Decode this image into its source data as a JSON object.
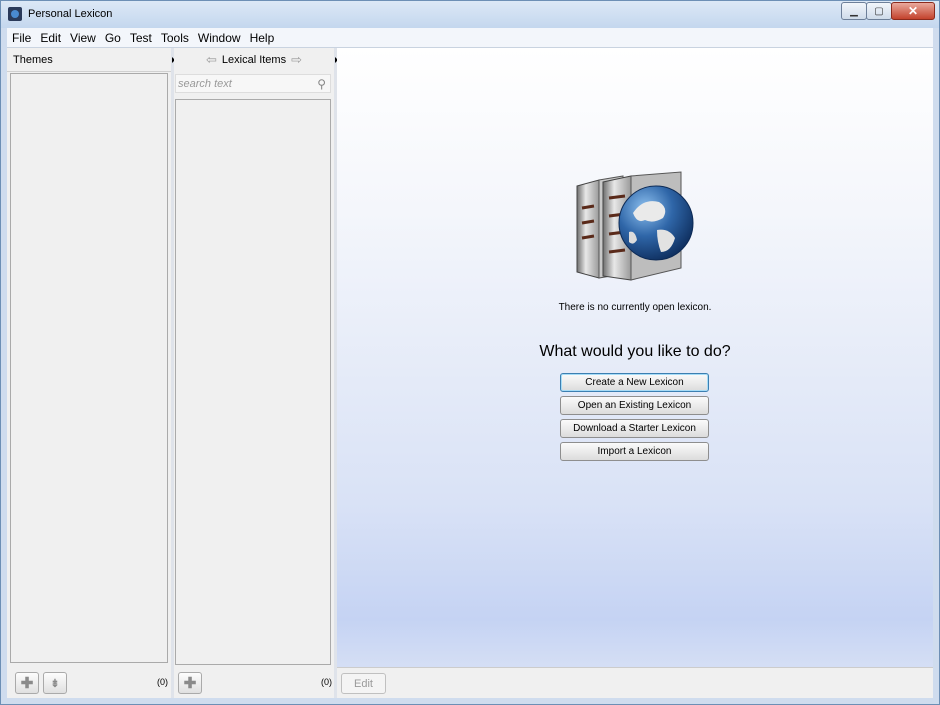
{
  "window": {
    "title": "Personal Lexicon"
  },
  "menubar": {
    "items": [
      "File",
      "Edit",
      "View",
      "Go",
      "Test",
      "Tools",
      "Window",
      "Help"
    ]
  },
  "themes_panel": {
    "header": "Themes",
    "count": "(0)"
  },
  "items_panel": {
    "header": "Lexical Items",
    "search_placeholder": "search text",
    "count": "(0)"
  },
  "main": {
    "status": "There is no currently open lexicon.",
    "prompt": "What would you like to do?",
    "buttons": [
      "Create a New Lexicon",
      "Open an Existing Lexicon",
      "Download a Starter Lexicon",
      "Import a Lexicon"
    ],
    "edit_label": "Edit"
  },
  "colors": {
    "title_bar": "#c4d7ee",
    "close_button": "#c3422c",
    "main_gradient_bottom": "#c5d3f3",
    "globe_blue": "#2f66a8"
  },
  "icons": [
    "app-icon",
    "minimize-icon",
    "maximize-icon",
    "close-icon",
    "left-arrow-icon",
    "right-arrow-icon",
    "search-icon",
    "add-icon",
    "collapse-icon",
    "lexicon-logo"
  ]
}
